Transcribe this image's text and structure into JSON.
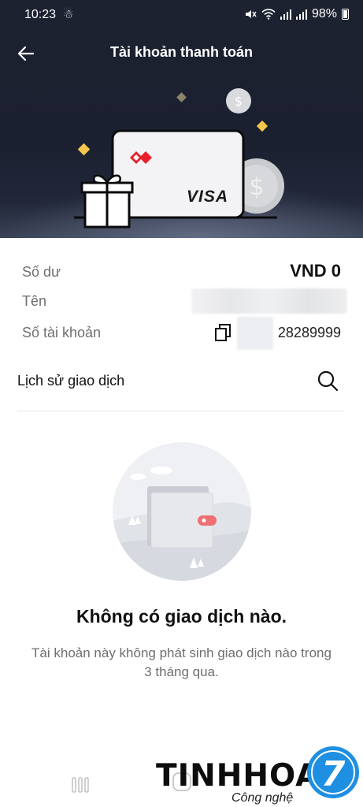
{
  "status_bar": {
    "time": "10:23",
    "battery": "98%"
  },
  "header": {
    "title": "Tài khoản thanh toán"
  },
  "card": {
    "brand": "VISA"
  },
  "account": {
    "balance_label": "Số dư",
    "balance_value": "VND 0",
    "name_label": "Tên",
    "number_label": "Số tài khoản",
    "number_value": "28289999"
  },
  "history": {
    "title": "Lịch sử giao dịch"
  },
  "empty_state": {
    "title": "Không có giao dịch nào.",
    "description": "Tài khoản này không phát sinh giao dịch nào trong 3 tháng qua."
  },
  "watermark": {
    "brand": "TINHHOA",
    "tagline": "Công nghệ",
    "badge": "7"
  },
  "colors": {
    "header_bg": "#1d2230",
    "brand_red": "#e8202a",
    "accent_yellow": "#f5c84c",
    "badge_blue": "#1e8fe1"
  }
}
